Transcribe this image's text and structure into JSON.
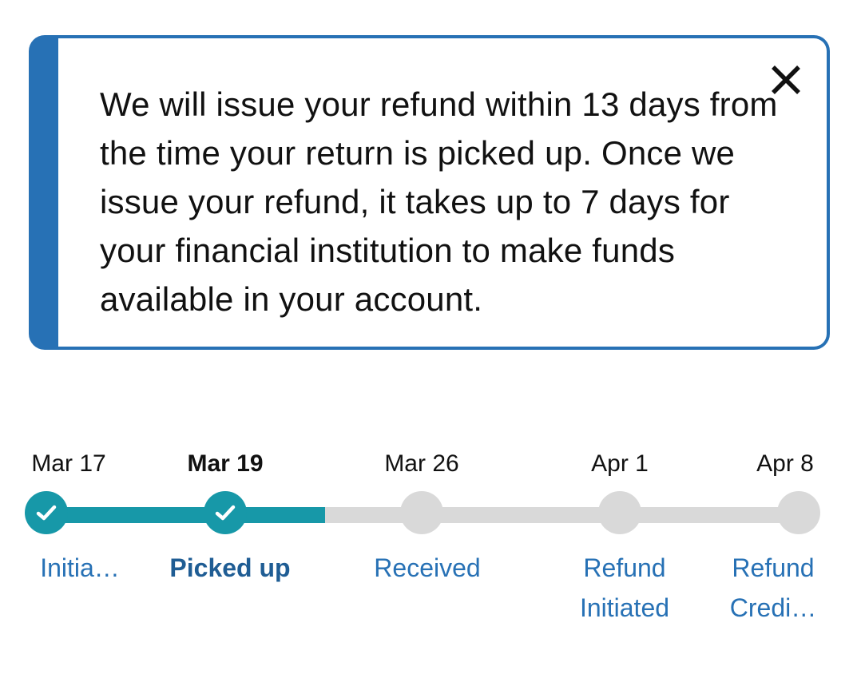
{
  "alert": {
    "message": "We will issue your refund within 13 days from the time your return is picked up. Once we issue your refund, it takes up to 7 days for your financial institution to make funds available in your account.",
    "close_icon": "close-icon",
    "accent_color": "#2771b5"
  },
  "timeline": {
    "progress_color": "#1798a8",
    "inactive_color": "#d9d9d9",
    "progress_fraction": 0.37,
    "steps": [
      {
        "date": "Mar 17",
        "label": "Initia…",
        "status": "done"
      },
      {
        "date": "Mar 19",
        "label": "Picked up",
        "status": "current"
      },
      {
        "date": "Mar 26",
        "label": "Received",
        "status": "pending"
      },
      {
        "date": "Apr 1",
        "label": "Refund Initiated",
        "status": "pending"
      },
      {
        "date": "Apr 8",
        "label": "Refund Credi…",
        "status": "pending"
      }
    ]
  }
}
